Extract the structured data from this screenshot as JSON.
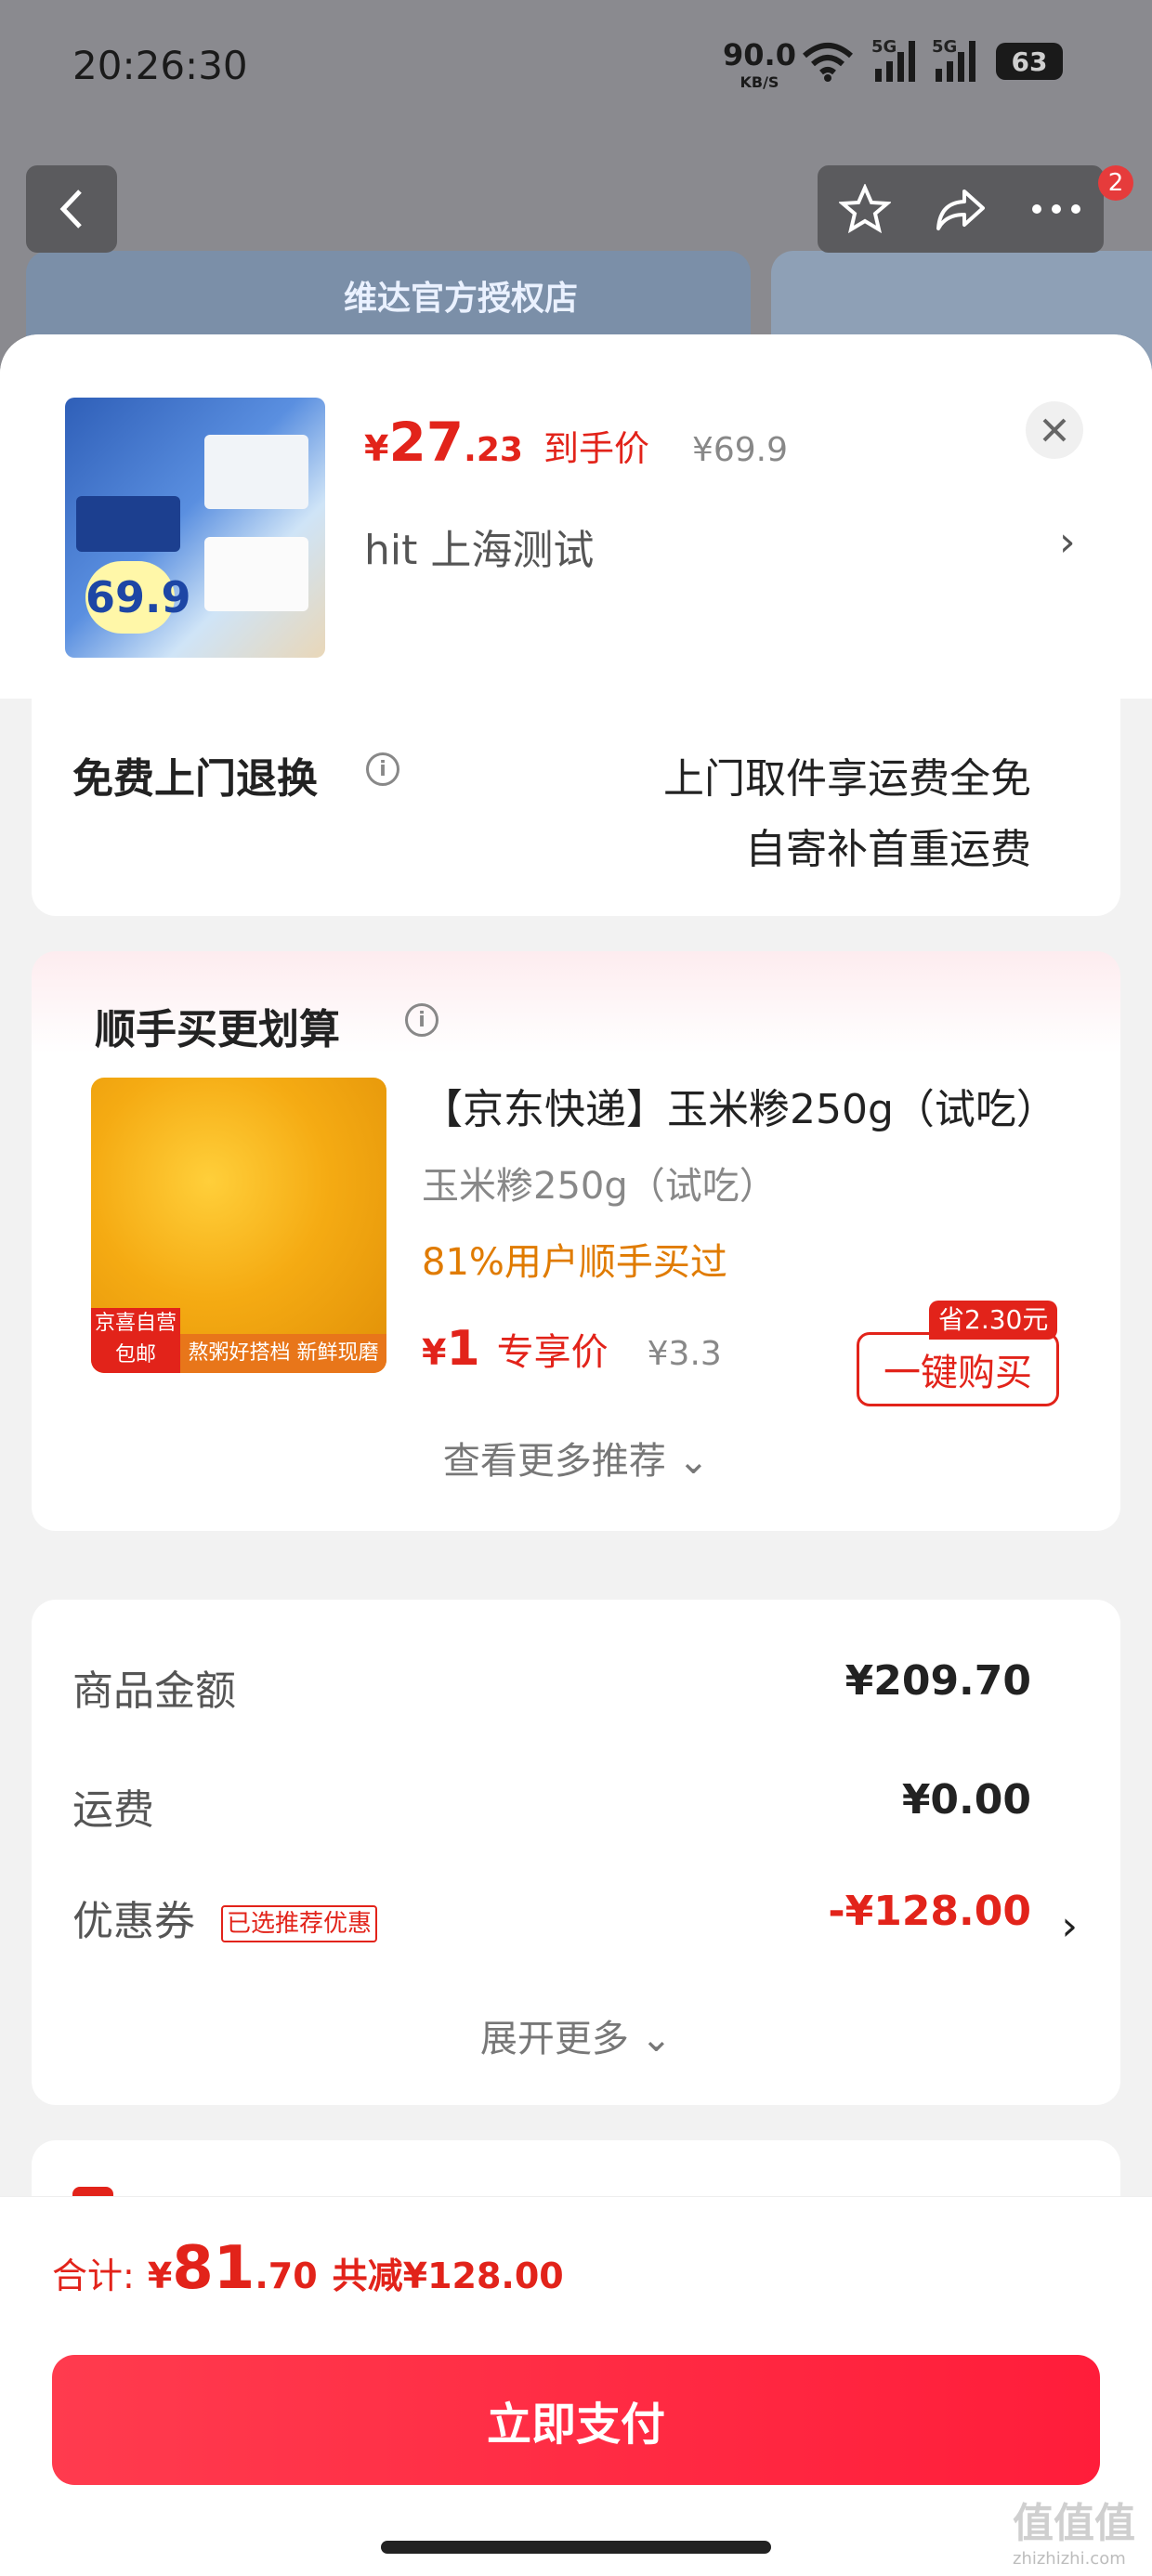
{
  "status_bar": {
    "time": "20:26:30",
    "net_speed": "90.0",
    "net_unit": "KB/S",
    "sim1": "5G",
    "sim2": "5G",
    "battery": "63"
  },
  "nav": {
    "cart_badge": "2"
  },
  "background": {
    "banner_text": "维达官方授权店"
  },
  "product": {
    "price_symbol": "¥",
    "price_int": "27",
    "price_dec": ".23",
    "price_tag": "到手价",
    "original_price": "¥69.9",
    "sku_text": "hit  上海测试",
    "thumb_badge": "69.9"
  },
  "return_service": {
    "title": "免费上门退换",
    "line1": "上门取件享运费全免",
    "line2": "自寄补首重运费"
  },
  "addon": {
    "title": "顺手买更划算",
    "item": {
      "name": "【京东快递】玉米糁250g（试吃）",
      "spec": "玉米糁250g（试吃）",
      "bought": "81%用户顺手买过",
      "price_symbol": "¥",
      "price_int": "1",
      "price_tag": "专享价",
      "original_price": "¥3.3",
      "save_tag": "省2.30元",
      "buy_label": "一键购买",
      "img_label_jd": "京喜自营 包邮",
      "img_label_bar": "熬粥好搭档  新鲜现磨"
    },
    "more_label": "查看更多推荐 ⌄"
  },
  "cost": {
    "goods_label": "商品金额",
    "goods_value": "¥209.70",
    "shipping_label": "运费",
    "shipping_value": "¥0.00",
    "coupon_label": "优惠券",
    "coupon_tag": "已选推荐优惠",
    "coupon_value": "-¥128.00",
    "expand_label": "展开更多 ⌄"
  },
  "footer": {
    "total_label": "合计:",
    "total_symbol": "¥",
    "total_int": "81",
    "total_dec": ".70",
    "total_saved": "共减¥128.00",
    "pay_label": "立即支付"
  },
  "watermark": {
    "main": "值值值",
    "sub": "zhizhizhi.com"
  },
  "colors": {
    "accent": "#e2231a",
    "pay_button": "#ff2a44",
    "bought_text": "#e07b00"
  }
}
